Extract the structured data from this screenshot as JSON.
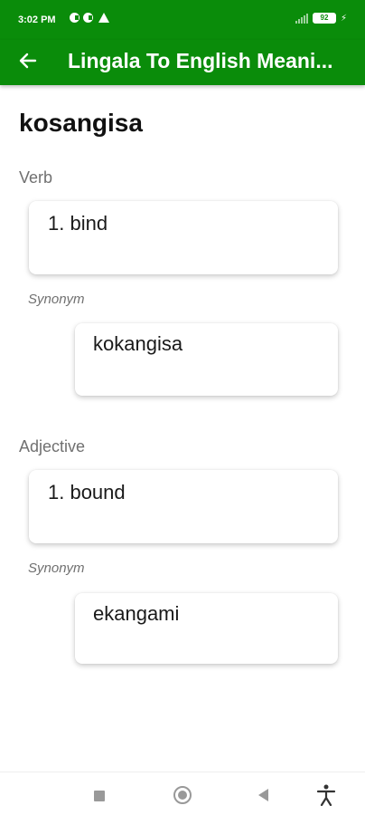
{
  "status_bar": {
    "time": "3:02 PM",
    "battery": "92",
    "icons": [
      "app-notification-icon",
      "app-notification-icon",
      "warning-icon",
      "signal-icon",
      "battery-icon",
      "charging-icon"
    ]
  },
  "app_bar": {
    "title": "Lingala To English Meani...",
    "back_icon": "arrow-left-icon",
    "color": "#0a8c0a"
  },
  "word": "kosangisa",
  "sections": [
    {
      "part_of_speech": "Verb",
      "meaning": "1. bind",
      "synonym_label": "Synonym",
      "synonym": "kokangisa"
    },
    {
      "part_of_speech": "Adjective",
      "meaning": "1. bound",
      "synonym_label": "Synonym",
      "synonym": "ekangami"
    }
  ],
  "nav_bar": {
    "icons": [
      "recent-apps-icon",
      "home-icon",
      "back-icon",
      "accessibility-icon"
    ]
  }
}
